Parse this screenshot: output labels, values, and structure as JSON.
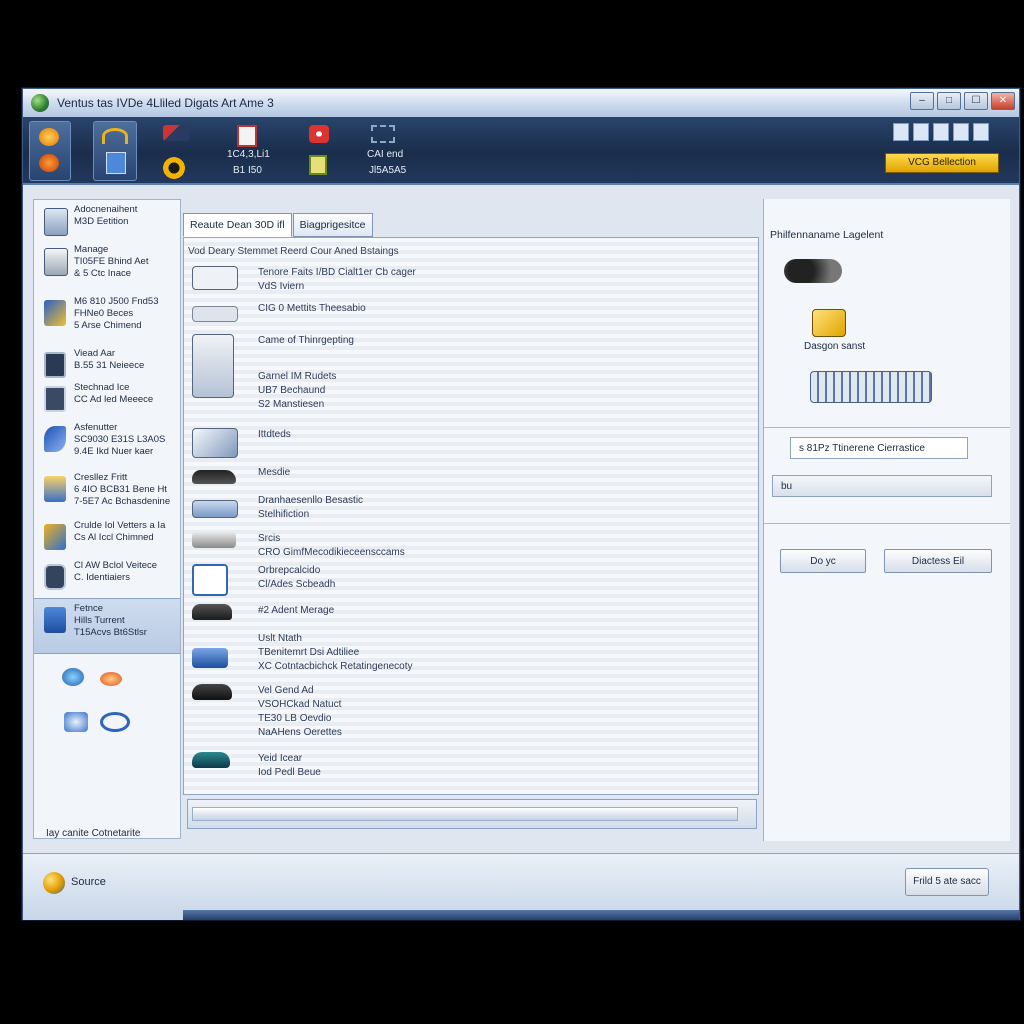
{
  "window": {
    "title": "Ventus tas IVDe 4Lliled Digats Art Ame 3"
  },
  "ribbon": {
    "label_a": "1C4,3,Li1",
    "label_b": "B1 I50",
    "label_c": "CAI end",
    "label_d": "Jl5A5A5",
    "vcg_button": "VCG Bellection"
  },
  "sidebar": {
    "items": [
      {
        "label": "Adocnenaihent\nM3D Eetition"
      },
      {
        "label": "Manage\nTI05FE Bhind Aet\n& 5 Ctc Inace"
      },
      {
        "label": "M6 810 J500 Fnd53\nFHNe0 Beces\n5 Arse Chimend"
      },
      {
        "label": "Viead Aar\nB.55 31 Neieece"
      },
      {
        "label": "Stechnad Ice\nCC Ad led Meeece"
      },
      {
        "label": "Asfenutter\nSC9030 E31S L3A0S\n9.4E Ikd Nuer kaer"
      },
      {
        "label": "Cresllez Fritt\n6 4IO BCB31 Bene Ht\n7-5E7 Ac Bchasdenine"
      },
      {
        "label": "Crulde Iol Vetters a Ia\nCs Al Iccl Chimned"
      },
      {
        "label": "Cl AW Bclol Veitece\nC. Identiaiers"
      },
      {
        "label": "Fetnce\nHills Turrent\nT15Acvs Bt6Stlsr"
      }
    ],
    "bottom_label": "Iay canite Cotnetarite"
  },
  "tabs": [
    {
      "label": "Reaute Dean 30D ifl"
    },
    {
      "label": "Biagprigesitce"
    }
  ],
  "list": {
    "header": "Vod Deary Stemmet    Reerd Cour Aned Bstaings",
    "rows": [
      {
        "text": "Tenore Faits    I/BD Cialt1er    Cb cager\nVdS Iviern"
      },
      {
        "text": "CIG 0 Mettits Theesabio"
      },
      {
        "text": "Came of Thinrgepting"
      },
      {
        "text": "Garnel IM Rudets\nUB7 Bechaund\nS2 Manstiesen"
      },
      {
        "text": "Ittdteds"
      },
      {
        "text": "Mesdie"
      },
      {
        "text": "Dranhaesenllo Besastic\nStelhifiction"
      },
      {
        "text": "Srcis\nCRO GimfMecodikieceensccams"
      },
      {
        "text": "Orbrepcalcido\nCl/Ades Scbeadh"
      },
      {
        "text": "#2 Adent Merage"
      },
      {
        "text": "Uslt Ntath\nTBenitemrt Dsi Adtiliee\nXC Cotntacbichck Retatingenecoty"
      },
      {
        "text": "Vel Gend Ad\nVSOHCkad Natuct\nTE30 LB Oevdio\nNaAHens Oerettes"
      },
      {
        "text": "Yeid Icear\nIod Pedl Beue"
      }
    ]
  },
  "right_panel": {
    "title": "Philfennaname Lagelent",
    "item_a_label": "Dasgon sanst",
    "field_a": "s 81Pz  Ttinerene Cierrastice",
    "field_b": "bu",
    "button_ok": "Do yc",
    "button_detail": "Diactess Eil"
  },
  "status": {
    "text": "Source",
    "button": "Frild 5 ate sacc"
  }
}
